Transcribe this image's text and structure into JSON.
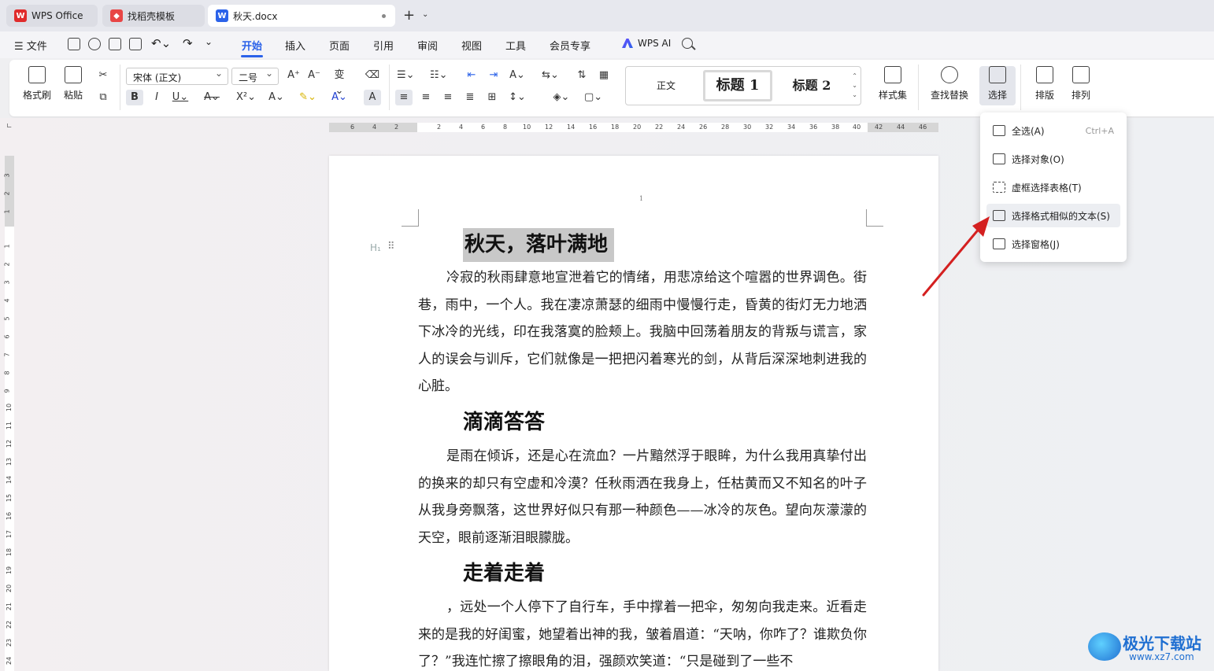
{
  "tabs": {
    "tab1": "WPS Office",
    "tab2": "找稻壳模板",
    "tab3": "秋天.docx",
    "add": "+",
    "more": "⌄"
  },
  "menu": {
    "file": "☰ 文件",
    "tabs": [
      "开始",
      "插入",
      "页面",
      "引用",
      "审阅",
      "视图",
      "工具",
      "会员专享"
    ],
    "wps_ai": "WPS AI"
  },
  "ribbon": {
    "format_painter": "格式刷",
    "paste": "粘贴",
    "font_name": "宋体 (正文)",
    "font_size": "二号",
    "styles": [
      "正文",
      "标题 1",
      "标题 2"
    ],
    "style_set": "样式集",
    "find_replace": "查找替换",
    "select": "选择",
    "layout": "排版",
    "arrange": "排列"
  },
  "ruler": {
    "h": [
      "6",
      "4",
      "2",
      "2",
      "4",
      "6",
      "8",
      "10",
      "12",
      "14",
      "16",
      "18",
      "20",
      "22",
      "24",
      "26",
      "28",
      "30",
      "32",
      "34",
      "36",
      "38",
      "40",
      "42",
      "44",
      "46"
    ],
    "v_top": [
      "3",
      "2",
      "1"
    ],
    "v": [
      "1",
      "2",
      "3",
      "4",
      "5",
      "6",
      "7",
      "8",
      "9",
      "10",
      "11",
      "12",
      "13",
      "14",
      "15",
      "16",
      "17",
      "18",
      "19",
      "20",
      "21",
      "22",
      "23",
      "24"
    ]
  },
  "document": {
    "page_number": "1",
    "heading1": "秋天，落叶满地",
    "para1": "冷寂的秋雨肆意地宣泄着它的情绪，用悲凉给这个喧嚣的世界调色。街巷，雨中，一个人。我在凄凉萧瑟的细雨中慢慢行走，昏黄的街灯无力地洒下冰冷的光线，印在我落寞的脸颊上。我脑中回荡着朋友的背叛与谎言，家人的误会与训斥，它们就像是一把把闪着寒光的剑，从背后深深地刺进我的心脏。",
    "heading2": "滴滴答答",
    "para2": "是雨在倾诉，还是心在流血？一片黯然浮于眼眸，为什么我用真挚付出的换来的却只有空虚和冷漠？任秋雨洒在我身上，任枯黄而又不知名的叶子从我身旁飘落，这世界好似只有那一种颜色——冰冷的灰色。望向灰濛濛的天空，眼前逐渐泪眼朦胧。",
    "heading3": "走着走着",
    "para3": "，远处一个人停下了自行车，手中撑着一把伞，匆匆向我走来。近看走来的是我的好闺蜜，她望着出神的我，皱着眉道：“天呐，你咋了？谁欺负你了？”我连忙擦了擦眼角的泪，强颜欢笑道：“只是碰到了一些不"
  },
  "dropdown": {
    "items": [
      {
        "label": "全选(A)",
        "shortcut": "Ctrl+A"
      },
      {
        "label": "选择对象(O)",
        "shortcut": ""
      },
      {
        "label": "虚框选择表格(T)",
        "shortcut": ""
      },
      {
        "label": "选择格式相似的文本(S)",
        "shortcut": ""
      },
      {
        "label": "选择窗格(J)",
        "shortcut": ""
      }
    ]
  },
  "watermark": {
    "name": "极光下载站",
    "url": "www.xz7.com"
  },
  "colors": {
    "accent": "#2b62e9",
    "arrow": "#d42020",
    "highlight": "#c8c8c8"
  }
}
